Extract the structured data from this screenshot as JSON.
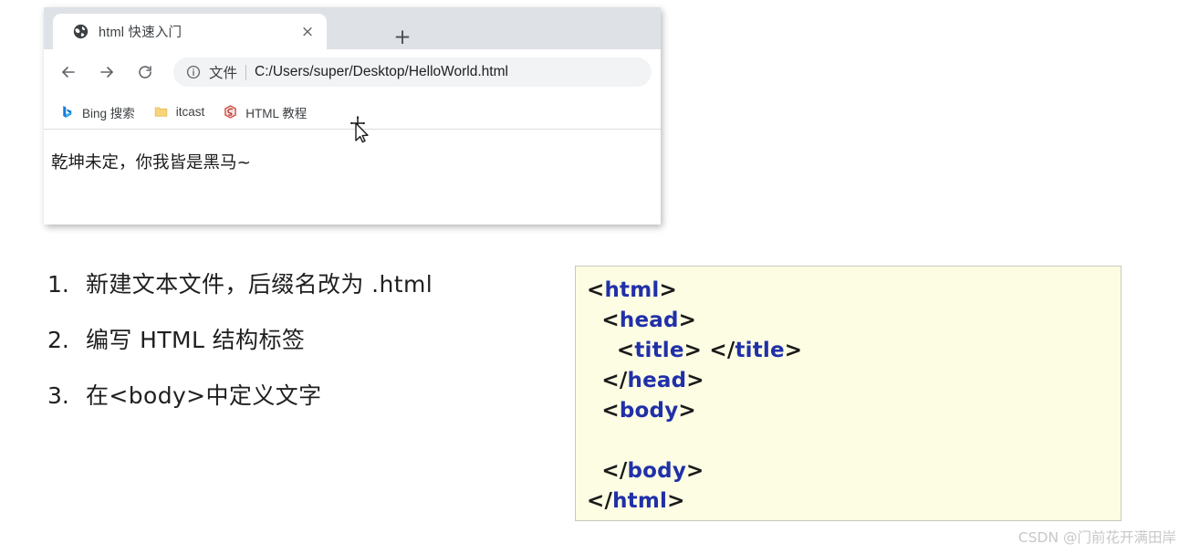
{
  "browser": {
    "tab": {
      "favicon": "globe-icon",
      "title": "html 快速入门",
      "close_label": "×"
    },
    "new_tab_label": "+",
    "toolbar": {
      "back_icon": "back-arrow-icon",
      "forward_icon": "forward-arrow-icon",
      "reload_icon": "reload-icon",
      "info_icon": "info-circle-icon",
      "scheme_label": "文件",
      "url": "C:/Users/super/Desktop/HelloWorld.html"
    },
    "bookmarks": [
      {
        "icon": "bing-icon",
        "label": "Bing 搜索"
      },
      {
        "icon": "folder-icon",
        "label": "itcast"
      },
      {
        "icon": "runoob-icon",
        "label": "HTML 教程"
      }
    ],
    "page_text": "乾坤未定，你我皆是黑马~"
  },
  "steps": [
    {
      "num": "1.",
      "text": "新建文本文件，后缀名改为 .html"
    },
    {
      "num": "2.",
      "text": "编写 HTML 结构标签"
    },
    {
      "num": "3.",
      "text": "在<body>中定义文字"
    }
  ],
  "code": {
    "lines": [
      {
        "indent": "",
        "bracket_open": "<",
        "tag": "html",
        "bracket_close": ">",
        "extra": ""
      },
      {
        "indent": "  ",
        "bracket_open": "<",
        "tag": "head",
        "bracket_close": ">",
        "extra": ""
      },
      {
        "indent": "    ",
        "bracket_open": "<",
        "tag": "title",
        "bracket_close": ">",
        "extra": " </title>"
      },
      {
        "indent": "  ",
        "bracket_open": "</",
        "tag": "head",
        "bracket_close": ">",
        "extra": ""
      },
      {
        "indent": "  ",
        "bracket_open": "<",
        "tag": "body",
        "bracket_close": ">",
        "extra": ""
      },
      {
        "indent": "",
        "bracket_open": "",
        "tag": "",
        "bracket_close": "",
        "extra": ""
      },
      {
        "indent": "  ",
        "bracket_open": "</",
        "tag": "body",
        "bracket_close": ">",
        "extra": ""
      },
      {
        "indent": "",
        "bracket_open": "</",
        "tag": "html",
        "bracket_close": ">",
        "extra": ""
      }
    ],
    "plain": [
      "<html>",
      "  <head>",
      "    <title> </title>",
      "  </head>",
      "  <body>",
      "",
      "  </body>",
      "</html>"
    ],
    "bracket_color": "#1a1a1a",
    "tag_color": "#2030a8",
    "background_color": "#fdfde4"
  },
  "watermark": "CSDN @门前花开满田岸"
}
